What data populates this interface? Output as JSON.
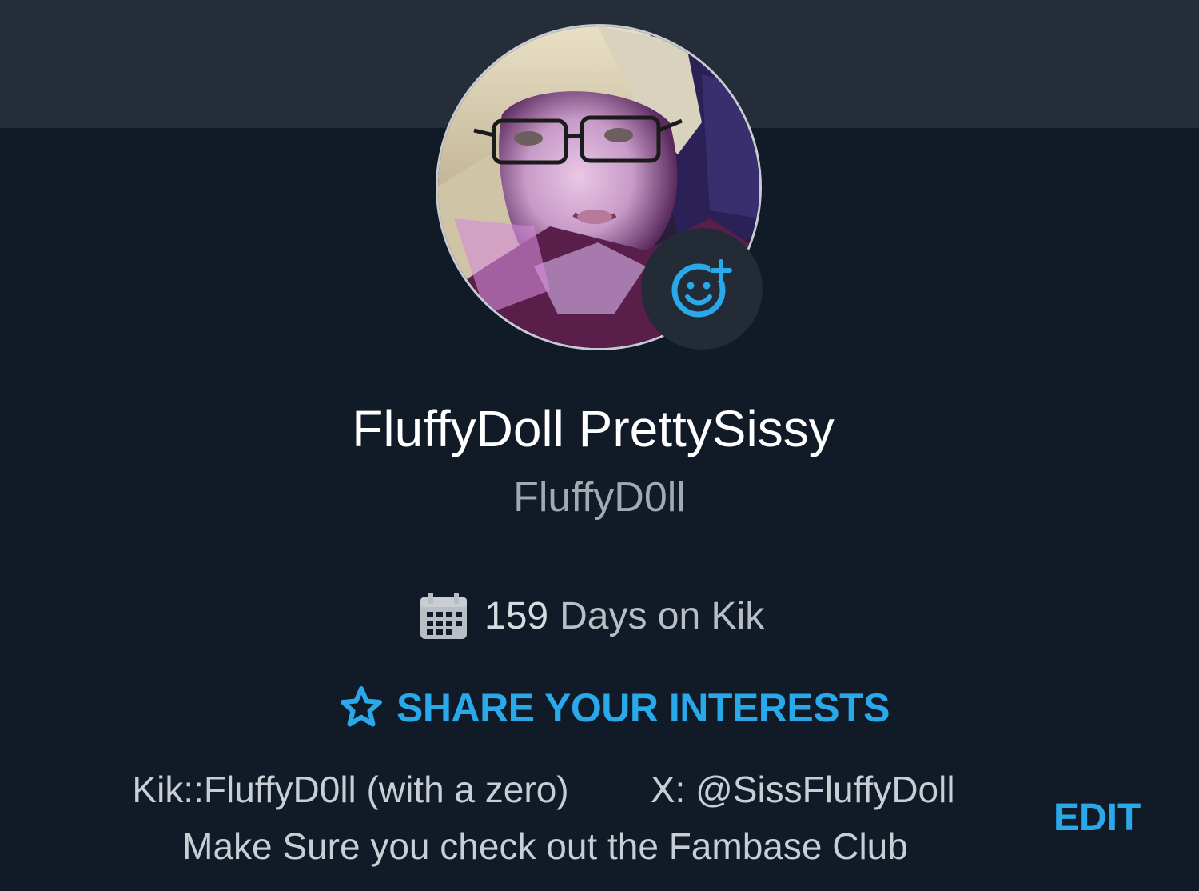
{
  "profile": {
    "display_name": "FluffyDoll PrettySissy",
    "username": "FluffyD0ll",
    "avatar_alt": "profile photo",
    "badge_icon": "add-emoji-icon"
  },
  "stats": {
    "days_count": "159",
    "days_suffix": "Days on Kik",
    "icon": "calendar-icon"
  },
  "interests": {
    "label": "SHARE YOUR INTERESTS",
    "icon": "star-outline-icon"
  },
  "bio": {
    "line1": "Kik::FluffyD0ll (with a zero)        X: @SissFluffyDoll",
    "line2": "Make Sure you check out the Fambase Club"
  },
  "actions": {
    "edit_label": "EDIT"
  },
  "colors": {
    "background": "#111b27",
    "header_band": "#242d38",
    "accent": "#2aa9ea",
    "primary_text": "#ffffff",
    "secondary_text": "#a3a9b0"
  }
}
